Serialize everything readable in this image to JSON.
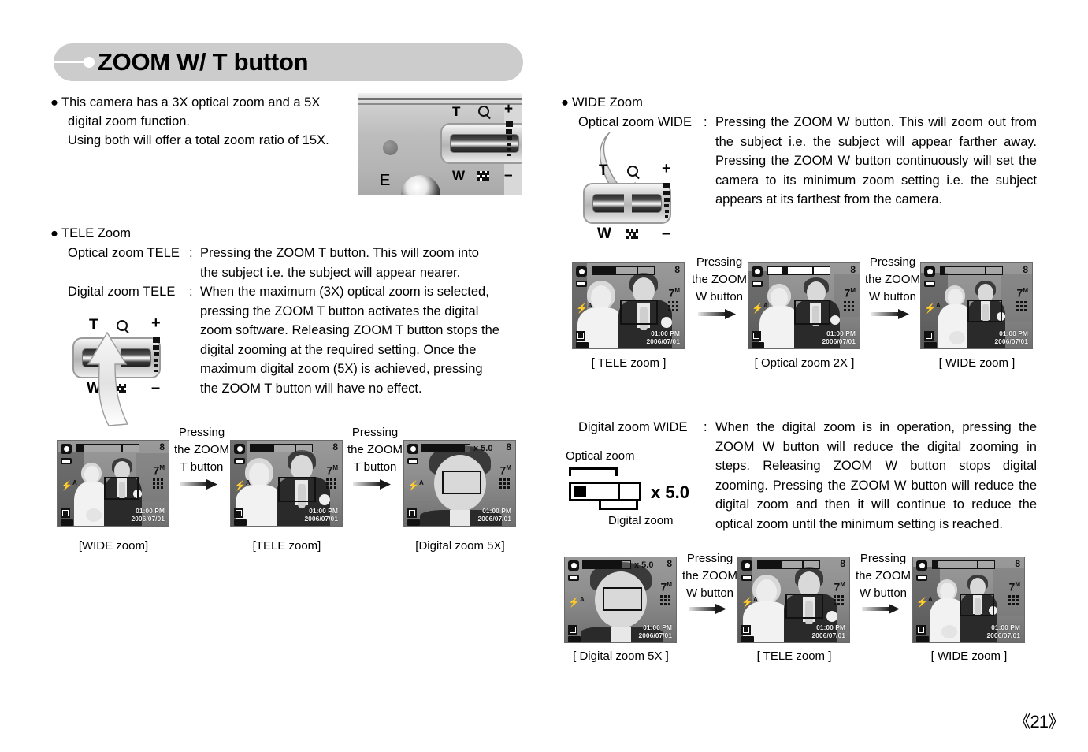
{
  "page": {
    "title": "ZOOM W/ T button",
    "number": "《21》"
  },
  "intro": {
    "bullet": "●",
    "line1": "This camera has a 3X optical zoom and a 5X",
    "line2": "digital zoom function.",
    "line3": "Using both will offer a total zoom ratio of 15X."
  },
  "camera_photo": {
    "name": "camera-zoom-lever-photo",
    "labels": {
      "T": "T",
      "W": "W",
      "E": "E",
      "plus": "+",
      "minus": "–"
    }
  },
  "lever_labels": {
    "T": "T",
    "W": "W",
    "plus": "+",
    "minus": "–"
  },
  "tele_section": {
    "bullet": "●",
    "heading": "TELE Zoom",
    "rows": [
      {
        "label": "Optical zoom TELE",
        "colon": ":",
        "text": "Pressing the ZOOM T button. This will zoom into the subject i.e. the subject will appear nearer."
      },
      {
        "label": "Digital zoom TELE",
        "colon": ":",
        "text": "When the maximum (3X) optical zoom is selected, pressing the ZOOM T button activates the digital zoom software. Releasing ZOOM T button stops the digital zooming at the required setting. Once the maximum digital zoom (5X) is achieved, pressing the ZOOM T button will have no effect."
      }
    ]
  },
  "wide_section": {
    "bullet": "●",
    "heading": "WIDE Zoom",
    "rows": [
      {
        "label": "Optical zoom WIDE",
        "colon": ":",
        "text": "Pressing the ZOOM W button. This will zoom out from the subject i.e. the subject will appear farther away. Pressing the ZOOM W button continuously will set the camera to its minimum zoom setting i.e. the subject appears at its farthest from the camera."
      },
      {
        "label": "Digital zoom WIDE",
        "colon": ":",
        "text": "When the digital zoom is in operation, pressing the ZOOM W button will reduce the digital zooming in steps. Releasing ZOOM W button stops digital zooming. Pressing the ZOOM W button will reduce the digital zoom and then it will continue to reduce the optical zoom until the minimum setting is reached."
      }
    ]
  },
  "zoom_bar_diagram": {
    "optical_label": "Optical zoom",
    "digital_label": "Digital zoom",
    "magnification": "x 5.0"
  },
  "lcd_osd": {
    "shots_remaining": "8",
    "resolution": "7",
    "resolution_unit": "M",
    "time": "01:00 PM",
    "date": "2006/07/01",
    "zoom_x": "x 5.0",
    "flash": "⚡",
    "flash_mode": "A"
  },
  "sequences": [
    {
      "name": "tele-zoom-sequence",
      "press_label_1": [
        "Pressing",
        "the ZOOM",
        "T button"
      ],
      "press_label_2": [
        "Pressing",
        "the ZOOM",
        "T button"
      ],
      "captions": [
        "[WIDE zoom]",
        "[TELE zoom]",
        "[Digital zoom 5X]"
      ]
    },
    {
      "name": "optical-wide-zoom-sequence",
      "press_label_1": [
        "Pressing",
        "the ZOOM",
        "W button"
      ],
      "press_label_2": [
        "Pressing",
        "the ZOOM",
        "W button"
      ],
      "captions": [
        "[ TELE zoom ]",
        "[ Optical zoom 2X ]",
        "[ WIDE zoom ]"
      ]
    },
    {
      "name": "digital-wide-zoom-sequence",
      "press_label_1": [
        "Pressing",
        "the ZOOM",
        "W button"
      ],
      "press_label_2": [
        "Pressing",
        "the ZOOM",
        "W button"
      ],
      "captions": [
        "[ Digital zoom 5X ]",
        "[ TELE zoom ]",
        "[ WIDE zoom ]"
      ]
    }
  ],
  "colors": {
    "header_bg": "#cccccc",
    "text": "#000000",
    "page_bg": "#ffffff"
  }
}
